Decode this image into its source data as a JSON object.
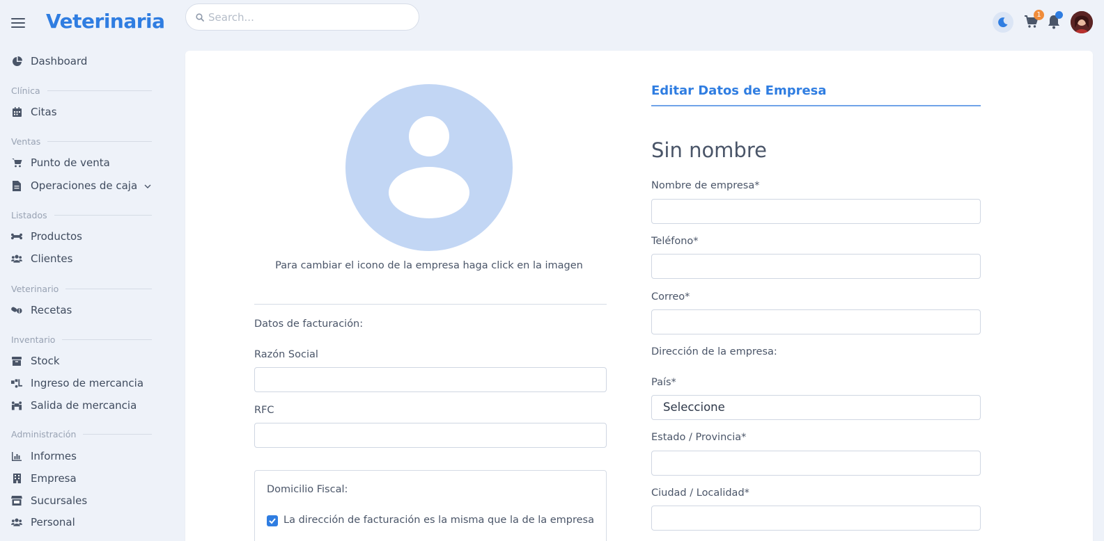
{
  "app": {
    "brand": "Veterinaria"
  },
  "header": {
    "search_placeholder": "Search...",
    "cart_count": "1"
  },
  "sidebar": {
    "dashboard": "Dashboard",
    "sections": {
      "clinica": "Clínica",
      "ventas": "Ventas",
      "listados": "Listados",
      "veterinario": "Veterinario",
      "inventario": "Inventario",
      "administracion": "Administración"
    },
    "items": {
      "citas": "Citas",
      "punto_venta": "Punto de venta",
      "operaciones_caja": "Operaciones de caja",
      "productos": "Productos",
      "clientes": "Clientes",
      "recetas": "Recetas",
      "stock": "Stock",
      "ingreso": "Ingreso de mercancia",
      "salida": "Salida de mercancia",
      "informes": "Informes",
      "empresa": "Empresa",
      "sucursales": "Sucursales",
      "personal": "Personal"
    }
  },
  "left_panel": {
    "logo_hint": "Para cambiar el icono de la empresa haga click en la imagen",
    "billing_title": "Datos de facturación:",
    "razon_social_label": "Razón Social",
    "razon_social_value": "",
    "rfc_label": "RFC",
    "rfc_value": "",
    "fiscal_title": "Domicilio Fiscal:",
    "same_address_label": "La dirección de facturación es la misma que la de la empresa",
    "same_address_checked": true
  },
  "right_panel": {
    "title": "Editar Datos de Empresa",
    "company_name": "Sin nombre",
    "nombre_label": "Nombre de empresa*",
    "nombre_value": "",
    "telefono_label": "Teléfono*",
    "telefono_value": "",
    "correo_label": "Correo*",
    "correo_value": "",
    "direccion_title": "Dirección de la empresa:",
    "pais_label": "País*",
    "pais_selected": "Seleccione",
    "estado_label": "Estado / Provincia*",
    "estado_value": "",
    "ciudad_label": "Ciudad / Localidad*",
    "ciudad_value": ""
  },
  "colors": {
    "accent": "#2f7de1",
    "background": "#eef2f9",
    "avatar_placeholder": "#c2d6f4",
    "badge": "#f08c3a"
  }
}
